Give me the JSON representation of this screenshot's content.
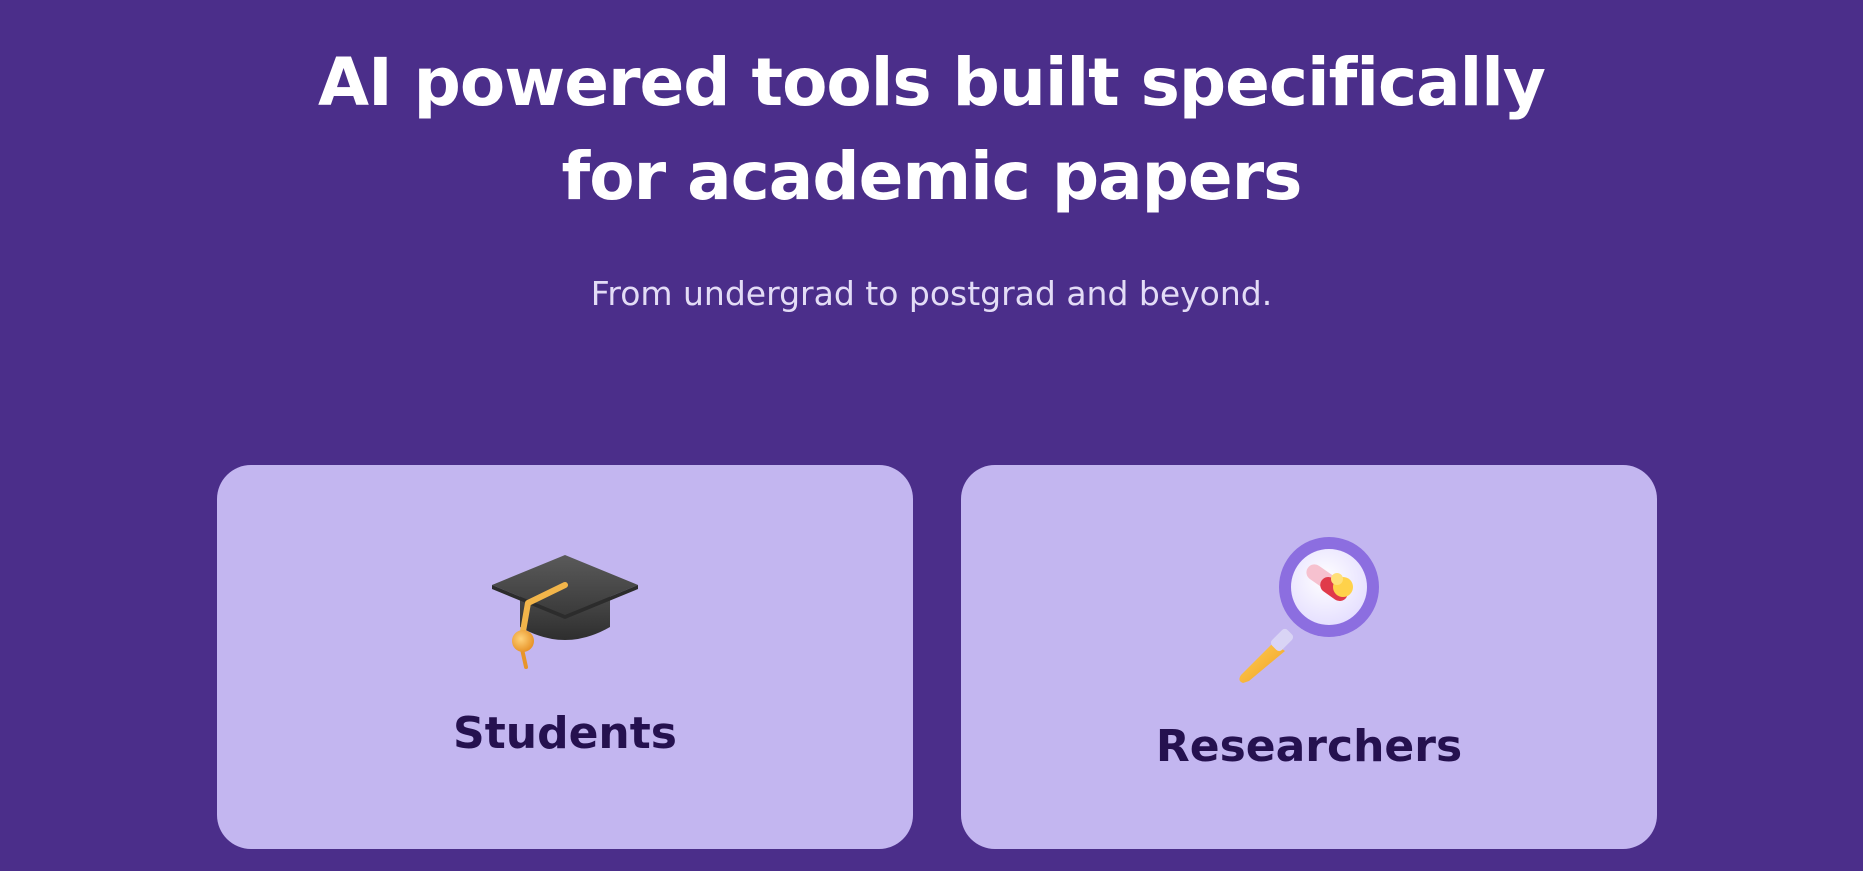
{
  "hero": {
    "title_line1": "AI powered tools built specifically",
    "title_line2": "for academic papers",
    "subtitle": "From undergrad to postgrad and beyond."
  },
  "cards": [
    {
      "label": "Students",
      "icon": "graduation-cap-icon"
    },
    {
      "label": "Researchers",
      "icon": "magnifying-glass-icon"
    }
  ],
  "colors": {
    "background": "#4b2e8a",
    "card_background": "#c3b6f0",
    "card_text": "#25114f",
    "title_text": "#ffffff",
    "subtitle_text": "#e3dcf6"
  }
}
